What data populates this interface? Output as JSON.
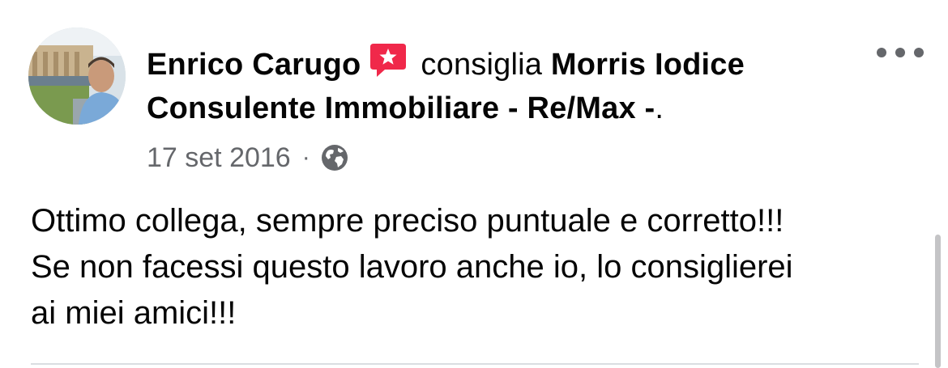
{
  "post": {
    "author": "Enrico Carugo",
    "action": "consiglia",
    "page_name": "Morris Iodice Consulente Immobiliare - Re/Max -",
    "page_name_suffix": ".",
    "date": "17 set 2016",
    "separator": "·",
    "body_lines": [
      "Ottimo collega, sempre preciso puntuale e corretto!!!",
      "Se non facessi questo lavoro anche io, lo consiglierei",
      "ai miei amici!!!"
    ]
  },
  "icons": {
    "recommend_badge": "recommend-star-badge",
    "privacy": "globe-icon",
    "more": "more-options-icon"
  },
  "colors": {
    "text_primary": "#050505",
    "text_secondary": "#65676b",
    "badge_red": "#f0284a",
    "divider": "#dadde1"
  }
}
